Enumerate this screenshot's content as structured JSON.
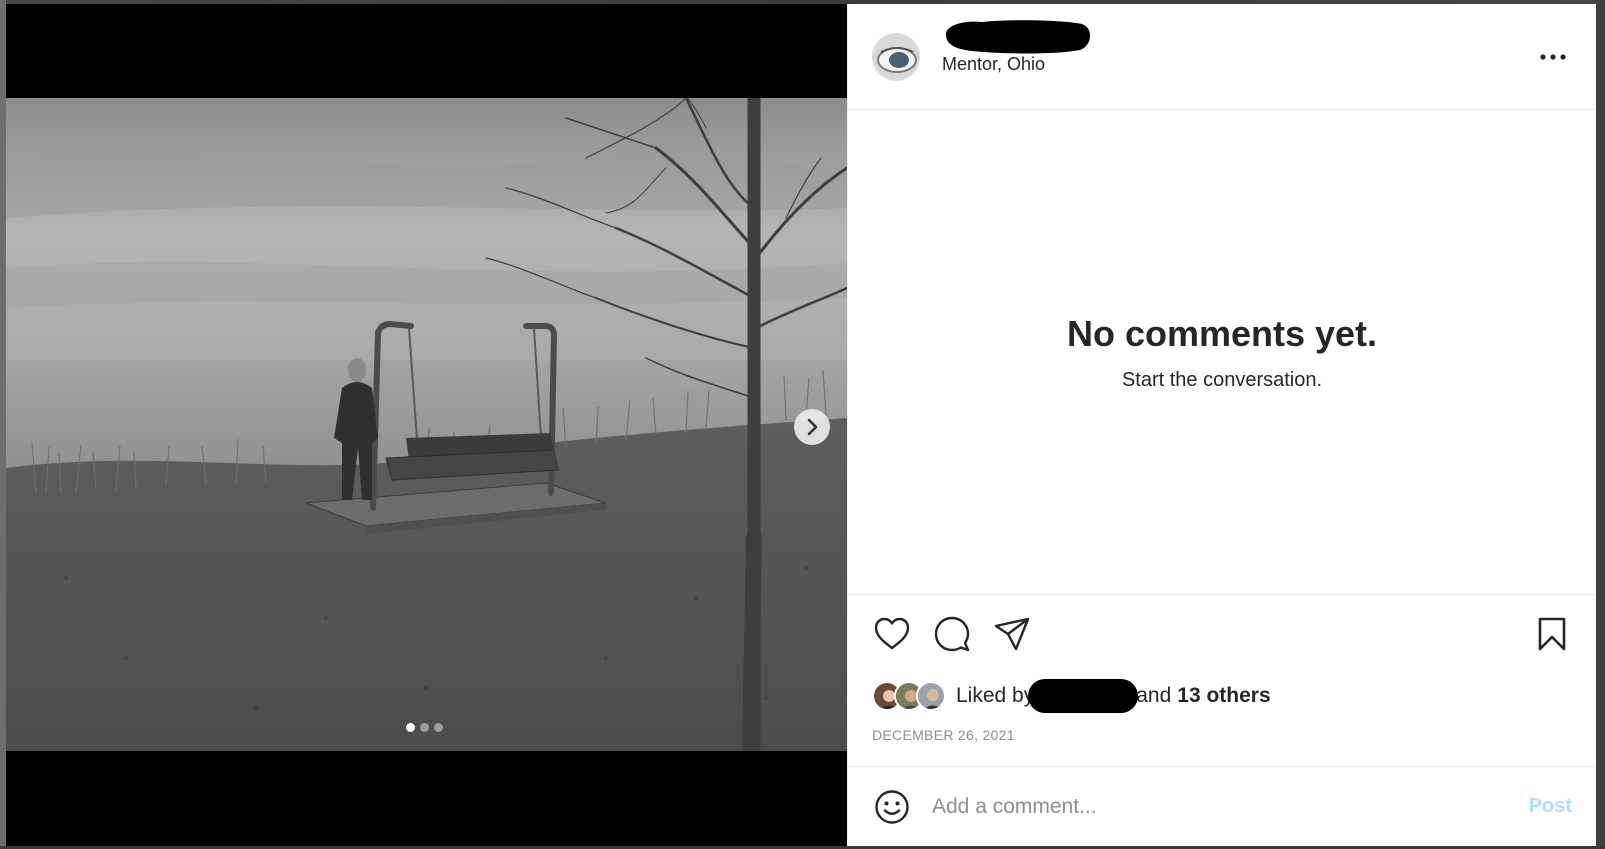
{
  "post": {
    "location": "Mentor, Ohio",
    "media_index": 0,
    "media_count": 3
  },
  "comments": {
    "empty_title": "No comments yet.",
    "empty_subtitle": "Start the conversation."
  },
  "likes": {
    "liked_by_prefix": "Liked by",
    "and_text": "and",
    "others": "13 others"
  },
  "date": "DECEMBER 26, 2021",
  "comment_bar": {
    "placeholder": "Add a comment...",
    "post_label": "Post"
  },
  "colors": {
    "post_disabled": "#b2dffc",
    "muted_text": "#8e8e8e",
    "primary_text": "#262626"
  },
  "icons": [
    "heart-icon",
    "comment-icon",
    "share-icon",
    "bookmark-icon",
    "more-icon",
    "emoji-icon",
    "chevron-right-icon"
  ]
}
